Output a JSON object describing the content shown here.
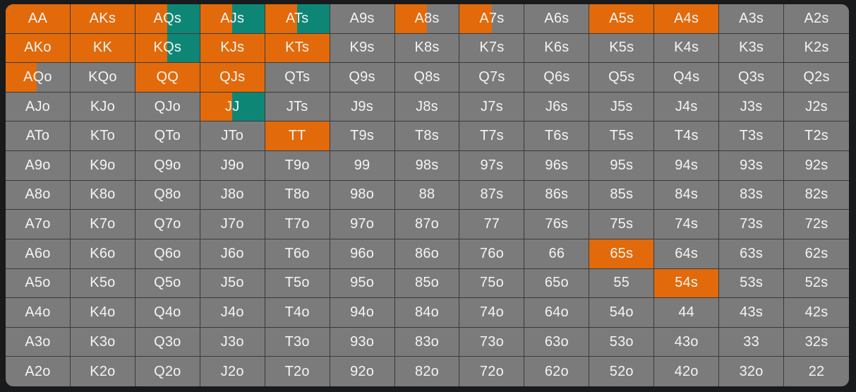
{
  "colors": {
    "fold": "#7b7b7b",
    "raise": "#e26a0a",
    "call": "#0e8676",
    "grid_line": "#3a3a3a",
    "text": "#f4f4f4"
  },
  "hands": [
    [
      "AA",
      "AKs",
      "AQs",
      "AJs",
      "ATs",
      "A9s",
      "A8s",
      "A7s",
      "A6s",
      "A5s",
      "A4s",
      "A3s",
      "A2s"
    ],
    [
      "AKo",
      "KK",
      "KQs",
      "KJs",
      "KTs",
      "K9s",
      "K8s",
      "K7s",
      "K6s",
      "K5s",
      "K4s",
      "K3s",
      "K2s"
    ],
    [
      "AQo",
      "KQo",
      "QQ",
      "QJs",
      "QTs",
      "Q9s",
      "Q8s",
      "Q7s",
      "Q6s",
      "Q5s",
      "Q4s",
      "Q3s",
      "Q2s"
    ],
    [
      "AJo",
      "KJo",
      "QJo",
      "JJ",
      "JTs",
      "J9s",
      "J8s",
      "J7s",
      "J6s",
      "J5s",
      "J4s",
      "J3s",
      "J2s"
    ],
    [
      "ATo",
      "KTo",
      "QTo",
      "JTo",
      "TT",
      "T9s",
      "T8s",
      "T7s",
      "T6s",
      "T5s",
      "T4s",
      "T3s",
      "T2s"
    ],
    [
      "A9o",
      "K9o",
      "Q9o",
      "J9o",
      "T9o",
      "99",
      "98s",
      "97s",
      "96s",
      "95s",
      "94s",
      "93s",
      "92s"
    ],
    [
      "A8o",
      "K8o",
      "Q8o",
      "J8o",
      "T8o",
      "98o",
      "88",
      "87s",
      "86s",
      "85s",
      "84s",
      "83s",
      "82s"
    ],
    [
      "A7o",
      "K7o",
      "Q7o",
      "J7o",
      "T7o",
      "97o",
      "87o",
      "77",
      "76s",
      "75s",
      "74s",
      "73s",
      "72s"
    ],
    [
      "A6o",
      "K6o",
      "Q6o",
      "J6o",
      "T6o",
      "96o",
      "86o",
      "76o",
      "66",
      "65s",
      "64s",
      "63s",
      "62s"
    ],
    [
      "A5o",
      "K5o",
      "Q5o",
      "J5o",
      "T5o",
      "95o",
      "85o",
      "75o",
      "65o",
      "55",
      "54s",
      "53s",
      "52s"
    ],
    [
      "A4o",
      "K4o",
      "Q4o",
      "J4o",
      "T4o",
      "94o",
      "84o",
      "74o",
      "64o",
      "54o",
      "44",
      "43s",
      "42s"
    ],
    [
      "A3o",
      "K3o",
      "Q3o",
      "J3o",
      "T3o",
      "93o",
      "83o",
      "73o",
      "63o",
      "53o",
      "43o",
      "33",
      "32s"
    ],
    [
      "A2o",
      "K2o",
      "Q2o",
      "J2o",
      "T2o",
      "92o",
      "82o",
      "72o",
      "62o",
      "52o",
      "42o",
      "32o",
      "22"
    ]
  ],
  "actions": {
    "AA": {
      "raise": 1.0
    },
    "AKs": {
      "raise": 1.0
    },
    "AQs": {
      "raise": 0.5,
      "call": 0.5
    },
    "AJs": {
      "raise": 0.5,
      "call": 0.5
    },
    "ATs": {
      "raise": 0.5,
      "call": 0.5
    },
    "A8s": {
      "raise": 0.5
    },
    "A7s": {
      "raise": 0.5
    },
    "A5s": {
      "raise": 1.0
    },
    "A4s": {
      "raise": 1.0
    },
    "AKo": {
      "raise": 1.0
    },
    "KK": {
      "raise": 1.0
    },
    "KQs": {
      "raise": 0.5,
      "call": 0.5
    },
    "KJs": {
      "raise": 1.0
    },
    "KTs": {
      "raise": 1.0
    },
    "AQo": {
      "raise": 0.48
    },
    "QQ": {
      "raise": 1.0
    },
    "QJs": {
      "raise": 1.0
    },
    "JJ": {
      "raise": 0.5,
      "call": 0.5
    },
    "TT": {
      "raise": 1.0
    },
    "65s": {
      "raise": 1.0
    },
    "54s": {
      "raise": 1.0
    }
  }
}
